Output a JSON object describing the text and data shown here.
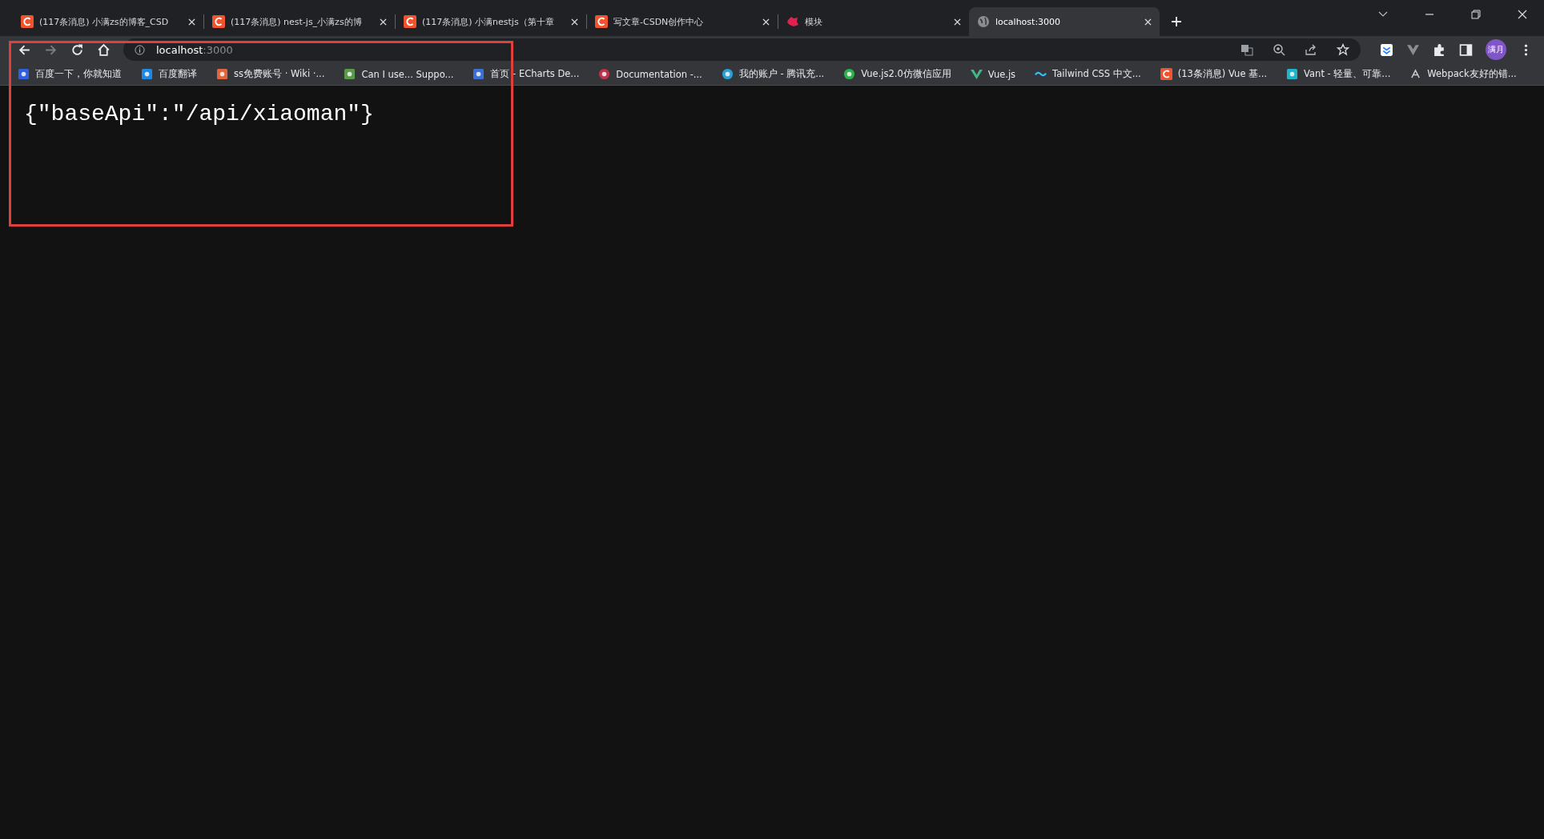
{
  "tabs": [
    {
      "title": "(117条消息) 小满zs的博客_CSD",
      "selected": false
    },
    {
      "title": "(117条消息) nest-js_小满zs的博",
      "selected": false
    },
    {
      "title": "(117条消息) 小满nestjs（第十章",
      "selected": false
    },
    {
      "title": "写文章-CSDN创作中心",
      "selected": false
    },
    {
      "title": "模块",
      "selected": false
    },
    {
      "title": "localhost:3000",
      "selected": true
    }
  ],
  "address_bar": {
    "host": "localhost",
    "port": ":3000"
  },
  "profile": {
    "initials": "满月"
  },
  "bookmarks": [
    {
      "label": "百度一下，你就知道"
    },
    {
      "label": "百度翻译"
    },
    {
      "label": "ss免费账号 · Wiki ·..."
    },
    {
      "label": "Can I use... Suppo..."
    },
    {
      "label": "首页 - ECharts De..."
    },
    {
      "label": "Documentation -..."
    },
    {
      "label": "我的账户 - 腾讯充..."
    },
    {
      "label": "Vue.js2.0仿微信应用"
    },
    {
      "label": "Vue.js"
    },
    {
      "label": "Tailwind CSS 中文..."
    },
    {
      "label": "(13条消息) Vue 基..."
    },
    {
      "label": "Vant - 轻量、可靠..."
    },
    {
      "label": "Webpack友好的错..."
    }
  ],
  "page": {
    "body": "{\"baseApi\":\"/api/xiaoman\"}"
  }
}
